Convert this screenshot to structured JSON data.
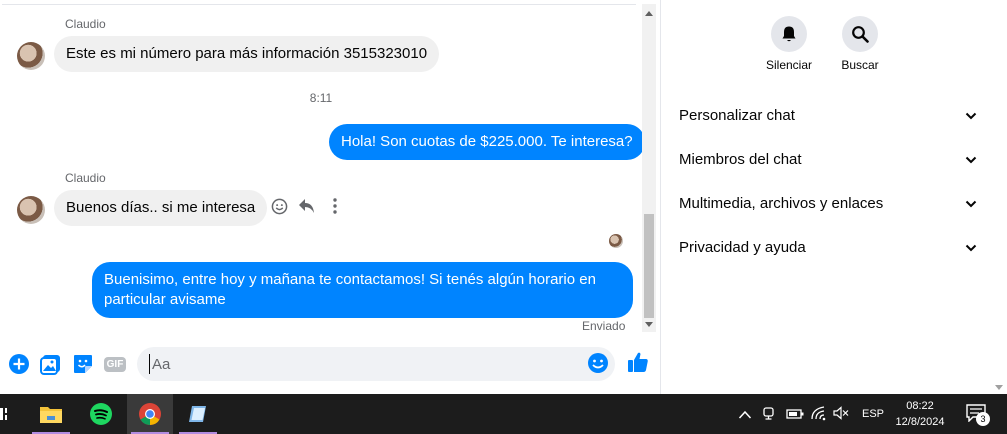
{
  "chat": {
    "messages": [
      {
        "sender": "Claudio",
        "text": "Este es mi número para más información 3515323010",
        "direction": "in"
      },
      {
        "time": "8:11"
      },
      {
        "text": "Hola! Son cuotas de $225.000. Te interesa?",
        "direction": "out"
      },
      {
        "sender": "Claudio",
        "text": "Buenos días..  si me interesa",
        "direction": "in"
      },
      {
        "text": "Buenisimo, entre hoy y mañana te contactamos! Si tenés algún horario en particular avisame",
        "direction": "out"
      }
    ],
    "message_actions": [
      "react-icon",
      "reply-icon",
      "more-icon"
    ],
    "status": "Enviado",
    "colors": {
      "outgoing": "#0084ff",
      "incoming": "#f0f0f0"
    }
  },
  "composer": {
    "placeholder": "Aa",
    "icons": [
      "add-icon",
      "image-icon",
      "sticker-icon",
      "gif-icon",
      "emoji-icon",
      "like-icon"
    ],
    "gif_label": "GIF"
  },
  "info": {
    "actions": [
      {
        "label": "Silenciar",
        "icon": "bell-icon"
      },
      {
        "label": "Buscar",
        "icon": "search-icon"
      }
    ],
    "sections": [
      {
        "label": "Personalizar chat"
      },
      {
        "label": "Miembros del chat"
      },
      {
        "label": "Multimedia, archivos y enlaces"
      },
      {
        "label": "Privacidad y ayuda"
      }
    ]
  },
  "taskbar": {
    "apps": [
      "file-explorer-icon",
      "spotify-icon",
      "chrome-icon",
      "notepad-icon"
    ],
    "language": "ESP",
    "time": "08:22",
    "date": "12/8/2024",
    "notifications": "3"
  }
}
